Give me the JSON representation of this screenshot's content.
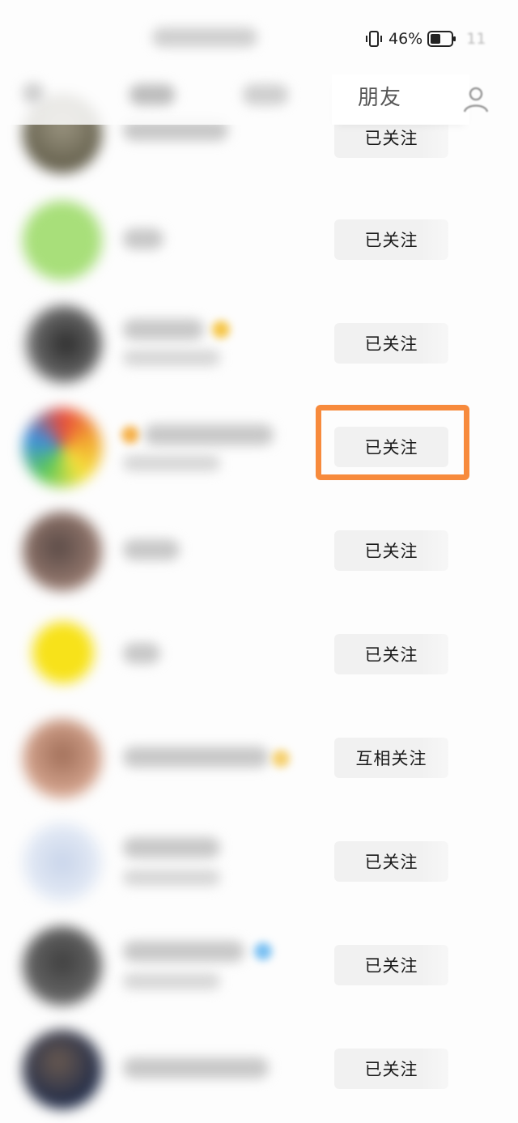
{
  "status_bar": {
    "battery_percent": "46%",
    "clock": "11",
    "icons": [
      "vibrate-icon",
      "battery-icon"
    ]
  },
  "tabs": {
    "friends": "朋友",
    "icons": [
      "person-icon"
    ]
  },
  "follow_list": {
    "rows": [
      {
        "button": "已关注"
      },
      {
        "button": "已关注"
      },
      {
        "button": "已关注"
      },
      {
        "button": "已关注"
      },
      {
        "button": "已关注"
      },
      {
        "button": "已关注"
      },
      {
        "button": "互相关注"
      },
      {
        "button": "已关注"
      },
      {
        "button": "已关注"
      },
      {
        "button": "已关注"
      }
    ]
  },
  "colors": {
    "highlight": "#f78a3c",
    "button_bg": "#f1f1f1",
    "background": "#fdfdfd"
  }
}
